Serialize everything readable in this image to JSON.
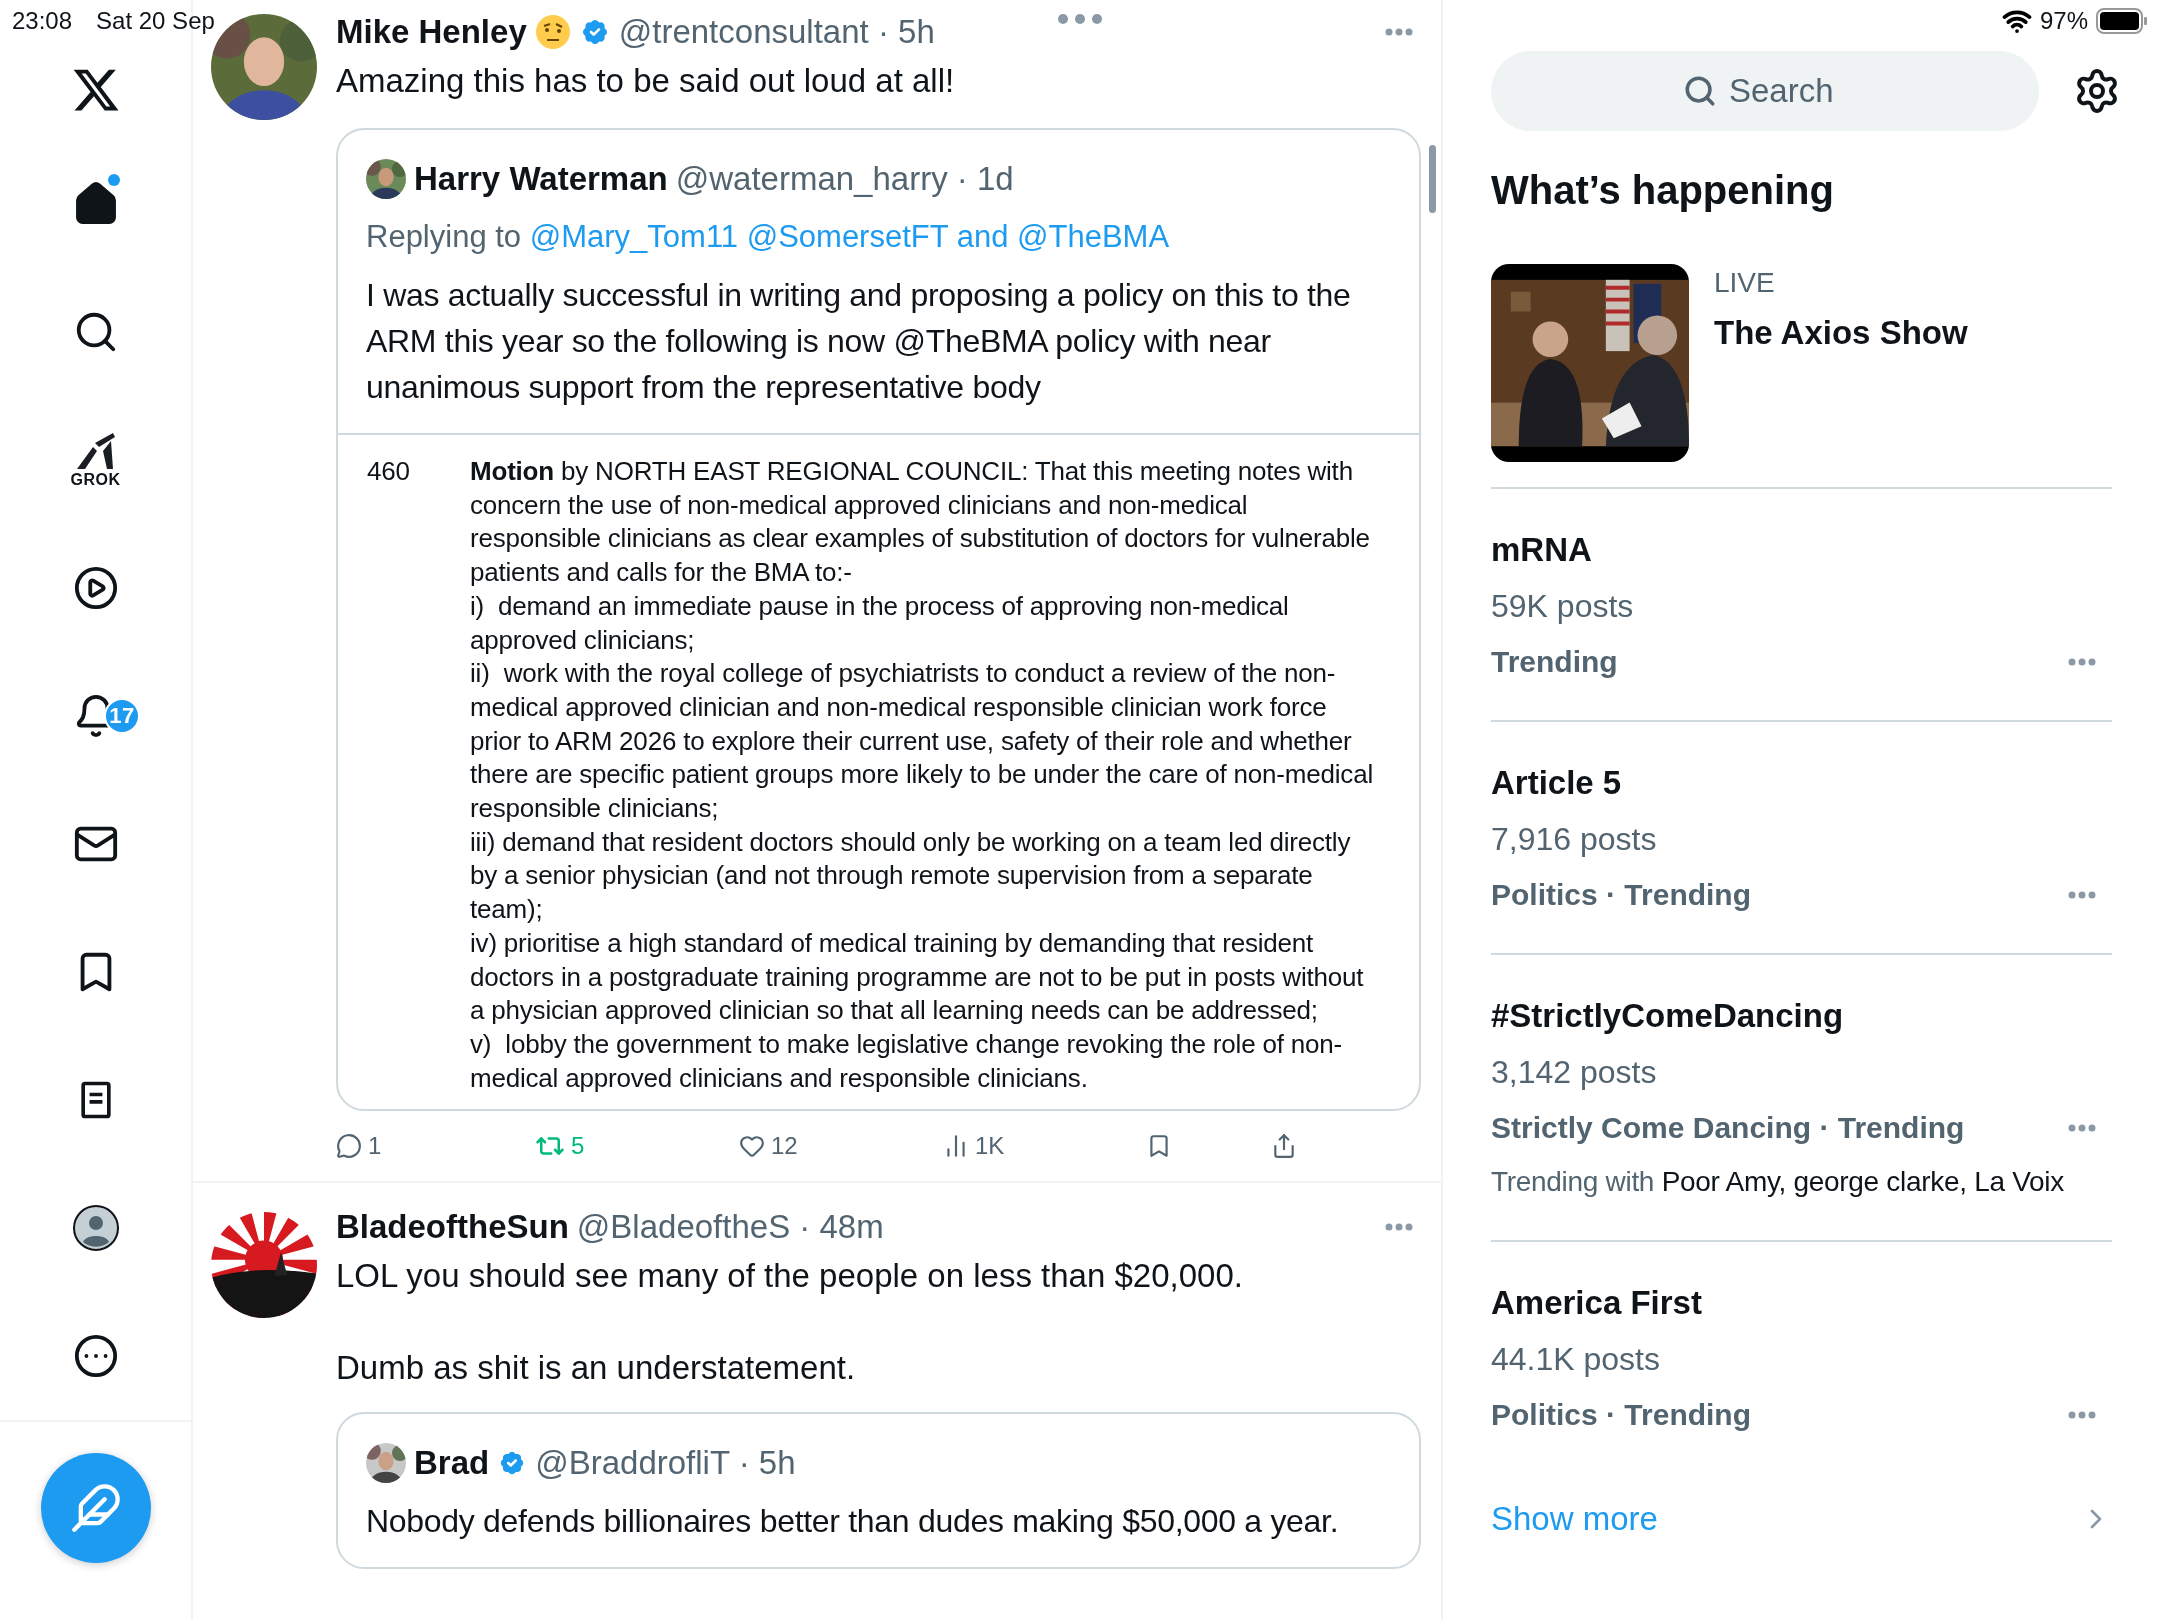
{
  "status_bar": {
    "time": "23:08",
    "date": "Sat 20 Sep",
    "battery": "97%"
  },
  "nav": {
    "items": [
      {
        "kind": "logo"
      },
      {
        "kind": "home",
        "selected": true,
        "has_update": true
      },
      {
        "kind": "search",
        "selected": false
      },
      {
        "kind": "grok",
        "selected": false,
        "label": "GROK"
      },
      {
        "kind": "video",
        "selected": false
      },
      {
        "kind": "notifications",
        "selected": false,
        "badge": "17"
      },
      {
        "kind": "messages",
        "selected": false
      },
      {
        "kind": "bookmarks",
        "selected": false
      },
      {
        "kind": "lists",
        "selected": false
      },
      {
        "kind": "profile",
        "selected": false
      },
      {
        "kind": "more",
        "selected": false
      }
    ]
  },
  "feed": [
    {
      "name": "Mike Henley",
      "name_emoji": true,
      "verified": true,
      "byline": "@trentconsultant · 5h",
      "paragraphs": [
        "Amazing this has to be said out loud at all!"
      ],
      "quote": {
        "name": "Harry Waterman",
        "verified": false,
        "byline": "@waterman_harry · 1d",
        "replying_prefix": "Replying to",
        "replying_to": "@Mary_Tom11 @SomersetFT and @TheBMA",
        "text": "I was actually successful in writing and proposing a policy on this to the ARM this year so the following is now @TheBMA policy with near unanimous support from the representative body",
        "document": {
          "number": "460",
          "paragraphs": [
            "**Motion** by NORTH EAST REGIONAL COUNCIL: That this meeting notes with concern the use of non-medical approved clinicians and non-medical responsible clinicians as clear examples of substitution of doctors for vulnerable patients and calls for the BMA to:-",
            "i)  demand an immediate pause in the process of approving non-medical approved clinicians;",
            "ii)  work with the royal college of psychiatrists to conduct a review of the non-medical approved clinician and non-medical responsible clinician work force prior to ARM 2026 to explore their current use, safety of their role and whether there are specific patient groups more likely to be under the care of non-medical responsible clinicians;",
            "iii) demand that resident doctors should only be working on a team led directly by a senior physician (and not through remote supervision from a separate team);",
            "iv) prioritise a high standard of medical training by demanding that resident doctors in a postgraduate training programme are not to be put in posts without a physician approved clinician so that all learning needs can be addressed;",
            "v)  lobby the government to make legislative change revoking the role of non-medical approved clinicians and responsible clinicians."
          ]
        }
      },
      "actions": [
        {
          "kind": "reply",
          "count": "1",
          "active": false
        },
        {
          "kind": "repost",
          "count": "5",
          "active": true
        },
        {
          "kind": "like",
          "count": "12",
          "active": false
        },
        {
          "kind": "views",
          "count": "1K"
        },
        {
          "kind": "bookmark",
          "active": false
        },
        {
          "kind": "share"
        }
      ]
    },
    {
      "name": "BladeoftheSun",
      "name_emoji": false,
      "verified": false,
      "byline": "@BladeoftheS · 48m",
      "paragraphs": [
        "LOL you should see many of the people on less than $20,000.",
        "Dumb as shit is an understatement."
      ],
      "quote": {
        "name": "Brad",
        "verified": true,
        "byline": "@BraddrofliT · 5h",
        "text": "Nobody defends billionaires better than dudes making $50,000 a year."
      }
    }
  ],
  "sidebar": {
    "search": {
      "placeholder": "Search"
    },
    "heading": "What’s happening",
    "live": {
      "label": "LIVE",
      "title": "The Axios Show"
    },
    "trends": [
      {
        "title": "mRNA",
        "posts": "59K posts",
        "context": "Trending"
      },
      {
        "title": "Article 5",
        "posts": "7,916 posts",
        "context": "Politics · Trending"
      },
      {
        "title": "#StrictlyComeDancing",
        "posts": "3,142 posts",
        "context": "Strictly Come Dancing · Trending",
        "trending_with_label": "Trending with",
        "trending_with": "Poor Amy, george clarke, La Voix"
      },
      {
        "title": "America First",
        "posts": "44.1K posts",
        "context": "Politics · Trending"
      }
    ],
    "show_more": "Show more"
  }
}
